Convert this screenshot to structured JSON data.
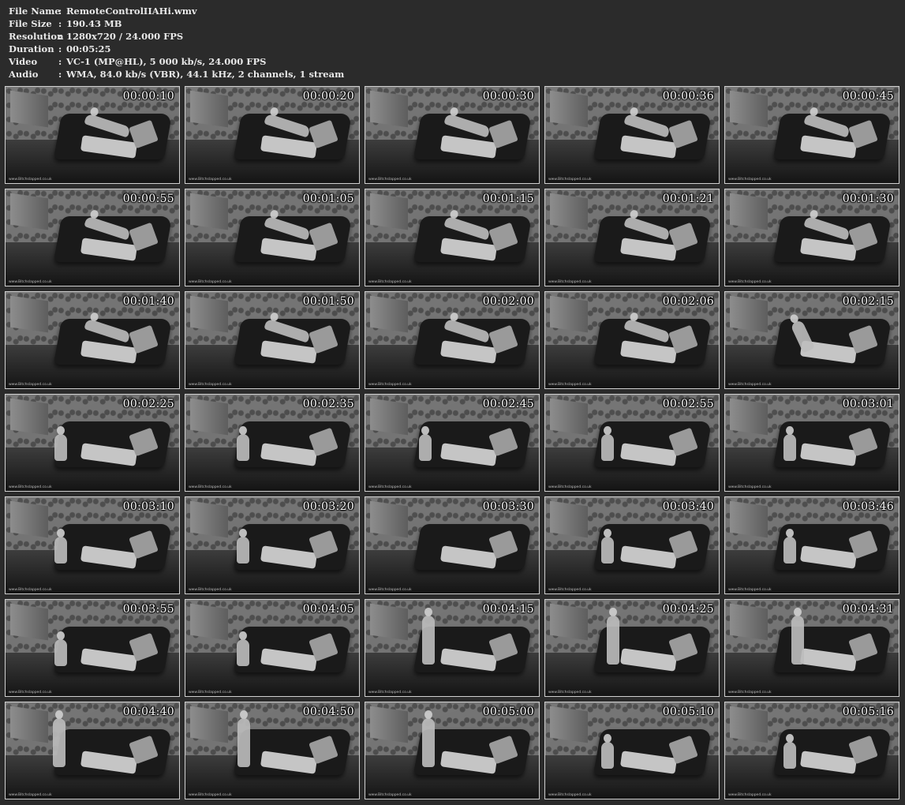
{
  "info": [
    {
      "label": "File Name",
      "value": "RemoteControlIIAHi.wmv"
    },
    {
      "label": "File Size",
      "value": "190.43 MB"
    },
    {
      "label": "Resolution",
      "value": "1280x720 / 24.000 FPS"
    },
    {
      "label": "Duration",
      "value": "00:05:25"
    },
    {
      "label": "Video",
      "value": "VC-1 (MP@HL), 5 000 kb/s, 24.000 FPS"
    },
    {
      "label": "Audio",
      "value": "WMA, 84.0 kb/s (VBR), 44.1 kHz, 2 channels, 1 stream"
    }
  ],
  "colon": ":",
  "watermark": "www.Bitchslapped.co.uk",
  "thumbnails": [
    {
      "time": "00:00:10",
      "pose": "lying"
    },
    {
      "time": "00:00:20",
      "pose": "lying"
    },
    {
      "time": "00:00:30",
      "pose": "lying"
    },
    {
      "time": "00:00:36",
      "pose": "lying"
    },
    {
      "time": "00:00:45",
      "pose": "lying"
    },
    {
      "time": "00:00:55",
      "pose": "lying"
    },
    {
      "time": "00:01:05",
      "pose": "lying"
    },
    {
      "time": "00:01:15",
      "pose": "lying"
    },
    {
      "time": "00:01:21",
      "pose": "lying"
    },
    {
      "time": "00:01:30",
      "pose": "lying"
    },
    {
      "time": "00:01:40",
      "pose": "lying"
    },
    {
      "time": "00:01:50",
      "pose": "lying"
    },
    {
      "time": "00:02:00",
      "pose": "lying"
    },
    {
      "time": "00:02:06",
      "pose": "lying"
    },
    {
      "time": "00:02:15",
      "pose": "sitting"
    },
    {
      "time": "00:02:25",
      "pose": "kneeling"
    },
    {
      "time": "00:02:35",
      "pose": "kneeling"
    },
    {
      "time": "00:02:45",
      "pose": "kneeling"
    },
    {
      "time": "00:02:55",
      "pose": "kneeling"
    },
    {
      "time": "00:03:01",
      "pose": "kneeling"
    },
    {
      "time": "00:03:10",
      "pose": "kneeling"
    },
    {
      "time": "00:03:20",
      "pose": "kneeling"
    },
    {
      "time": "00:03:30",
      "pose": "empty"
    },
    {
      "time": "00:03:40",
      "pose": "kneeling"
    },
    {
      "time": "00:03:46",
      "pose": "kneeling"
    },
    {
      "time": "00:03:55",
      "pose": "kneeling"
    },
    {
      "time": "00:04:05",
      "pose": "kneeling"
    },
    {
      "time": "00:04:15",
      "pose": "standing"
    },
    {
      "time": "00:04:25",
      "pose": "standing"
    },
    {
      "time": "00:04:31",
      "pose": "standing"
    },
    {
      "time": "00:04:40",
      "pose": "standing"
    },
    {
      "time": "00:04:50",
      "pose": "standing"
    },
    {
      "time": "00:05:00",
      "pose": "standing"
    },
    {
      "time": "00:05:10",
      "pose": "kneeling"
    },
    {
      "time": "00:05:16",
      "pose": "kneeling"
    }
  ]
}
